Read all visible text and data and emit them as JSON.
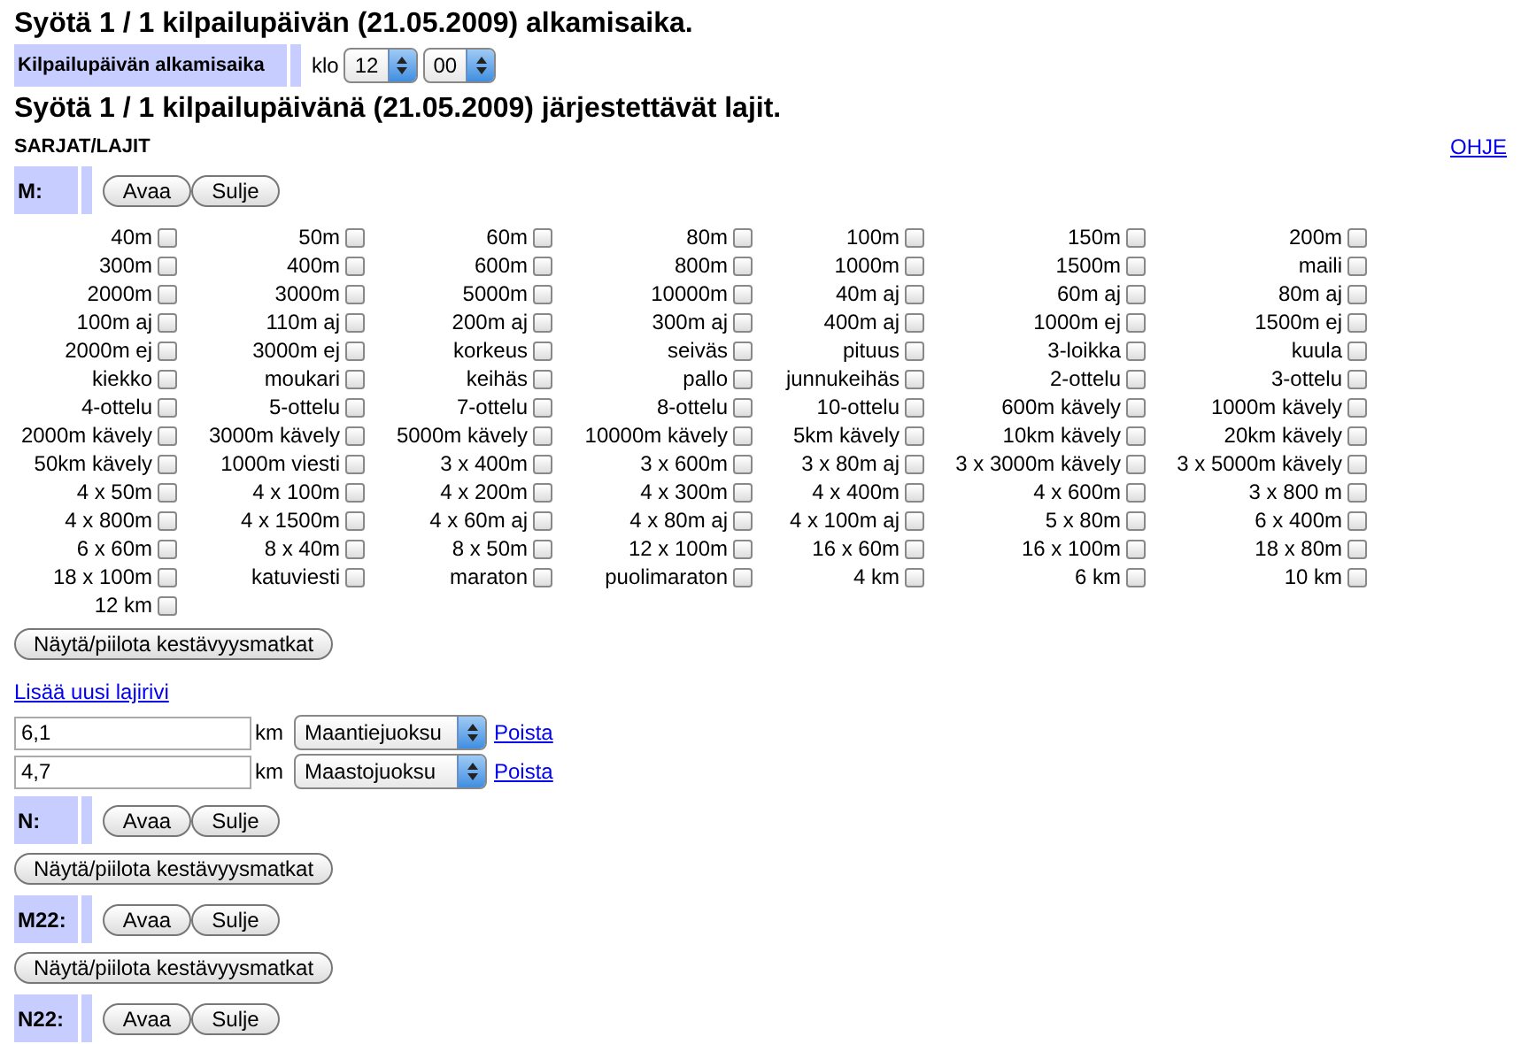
{
  "heading_start": "Syötä 1 / 1 kilpailupäivän (21.05.2009) alkamisaika.",
  "start_time": {
    "label": "Kilpailupäivän alkamisaika",
    "prefix": "klo",
    "hour": "12",
    "minute": "00"
  },
  "heading_events": "Syötä 1 / 1 kilpailupäivänä (21.05.2009) järjestettävät lajit.",
  "section_label": "SARJAT/LAJIT",
  "help_link": "OHJE",
  "series": [
    {
      "name": "M:",
      "buttons": [
        "Avaa",
        "Sulje"
      ],
      "events": [
        {
          "label": "40m",
          "checked": false
        },
        {
          "label": "50m",
          "checked": false
        },
        {
          "label": "60m",
          "checked": false
        },
        {
          "label": "80m",
          "checked": false
        },
        {
          "label": "100m",
          "checked": false
        },
        {
          "label": "150m",
          "checked": false
        },
        {
          "label": "200m",
          "checked": false
        },
        {
          "label": "300m",
          "checked": false
        },
        {
          "label": "400m",
          "checked": false
        },
        {
          "label": "600m",
          "checked": false
        },
        {
          "label": "800m",
          "checked": false
        },
        {
          "label": "1000m",
          "checked": false
        },
        {
          "label": "1500m",
          "checked": false
        },
        {
          "label": "maili",
          "checked": false
        },
        {
          "label": "2000m",
          "checked": false
        },
        {
          "label": "3000m",
          "checked": false
        },
        {
          "label": "5000m",
          "checked": false
        },
        {
          "label": "10000m",
          "checked": false
        },
        {
          "label": "40m aj",
          "checked": false
        },
        {
          "label": "60m aj",
          "checked": false
        },
        {
          "label": "80m aj",
          "checked": false
        },
        {
          "label": "100m aj",
          "checked": false
        },
        {
          "label": "110m aj",
          "checked": false
        },
        {
          "label": "200m aj",
          "checked": false
        },
        {
          "label": "300m aj",
          "checked": false
        },
        {
          "label": "400m aj",
          "checked": false
        },
        {
          "label": "1000m ej",
          "checked": false
        },
        {
          "label": "1500m ej",
          "checked": false
        },
        {
          "label": "2000m ej",
          "checked": false
        },
        {
          "label": "3000m ej",
          "checked": false
        },
        {
          "label": "korkeus",
          "checked": false
        },
        {
          "label": "seiväs",
          "checked": false
        },
        {
          "label": "pituus",
          "checked": false
        },
        {
          "label": "3-loikka",
          "checked": false
        },
        {
          "label": "kuula",
          "checked": false
        },
        {
          "label": "kiekko",
          "checked": false
        },
        {
          "label": "moukari",
          "checked": false
        },
        {
          "label": "keihäs",
          "checked": false
        },
        {
          "label": "pallo",
          "checked": false
        },
        {
          "label": "junnukeihäs",
          "checked": false
        },
        {
          "label": "2-ottelu",
          "checked": false
        },
        {
          "label": "3-ottelu",
          "checked": false
        },
        {
          "label": "4-ottelu",
          "checked": false
        },
        {
          "label": "5-ottelu",
          "checked": false
        },
        {
          "label": "7-ottelu",
          "checked": false
        },
        {
          "label": "8-ottelu",
          "checked": false
        },
        {
          "label": "10-ottelu",
          "checked": false
        },
        {
          "label": "600m kävely",
          "checked": false
        },
        {
          "label": "1000m kävely",
          "checked": false
        },
        {
          "label": "2000m kävely",
          "checked": false
        },
        {
          "label": "3000m kävely",
          "checked": false
        },
        {
          "label": "5000m kävely",
          "checked": false
        },
        {
          "label": "10000m kävely",
          "checked": false
        },
        {
          "label": "5km kävely",
          "checked": false
        },
        {
          "label": "10km kävely",
          "checked": false
        },
        {
          "label": "20km kävely",
          "checked": false
        },
        {
          "label": "50km kävely",
          "checked": false
        },
        {
          "label": "1000m viesti",
          "checked": false
        },
        {
          "label": "3 x 400m",
          "checked": false
        },
        {
          "label": "3 x 600m",
          "checked": false
        },
        {
          "label": "3 x 80m aj",
          "checked": false
        },
        {
          "label": "3 x 3000m kävely",
          "checked": false
        },
        {
          "label": "3 x 5000m kävely",
          "checked": false
        },
        {
          "label": "4 x 50m",
          "checked": false
        },
        {
          "label": "4 x 100m",
          "checked": false
        },
        {
          "label": "4 x 200m",
          "checked": false
        },
        {
          "label": "4 x 300m",
          "checked": false
        },
        {
          "label": "4 x 400m",
          "checked": false
        },
        {
          "label": "4 x 600m",
          "checked": false
        },
        {
          "label": "3 x 800 m",
          "checked": false
        },
        {
          "label": "4 x 800m",
          "checked": false
        },
        {
          "label": "4 x 1500m",
          "checked": false
        },
        {
          "label": "4 x 60m aj",
          "checked": false
        },
        {
          "label": "4 x 80m aj",
          "checked": false
        },
        {
          "label": "4 x 100m aj",
          "checked": false
        },
        {
          "label": "5 x 80m",
          "checked": false
        },
        {
          "label": "6 x 400m",
          "checked": false
        },
        {
          "label": "6 x 60m",
          "checked": false
        },
        {
          "label": "8 x 40m",
          "checked": false
        },
        {
          "label": "8 x 50m",
          "checked": false
        },
        {
          "label": "12 x 100m",
          "checked": false
        },
        {
          "label": "16 x 60m",
          "checked": false
        },
        {
          "label": "16 x 100m",
          "checked": false
        },
        {
          "label": "18 x 80m",
          "checked": false
        },
        {
          "label": "18 x 100m",
          "checked": false
        },
        {
          "label": "katuviesti",
          "checked": false
        },
        {
          "label": "maraton",
          "checked": false
        },
        {
          "label": "puolimaraton",
          "checked": false
        },
        {
          "label": "4 km",
          "checked": false
        },
        {
          "label": "6 km",
          "checked": false
        },
        {
          "label": "10 km",
          "checked": false
        },
        {
          "label": "12 km",
          "checked": false
        }
      ],
      "toggle_button": "Näytä/piilota kestävyysmatkat",
      "add_link": "Lisää uusi lajirivi",
      "custom_rows": [
        {
          "distance": "6,1",
          "unit": "km",
          "type": "Maantiejuoksu",
          "remove": "Poista"
        },
        {
          "distance": "4,7",
          "unit": "km",
          "type": "Maastojuoksu",
          "remove": "Poista"
        }
      ]
    },
    {
      "name": "N:",
      "buttons": [
        "Avaa",
        "Sulje"
      ],
      "toggle_button": "Näytä/piilota kestävyysmatkat"
    },
    {
      "name": "M22:",
      "buttons": [
        "Avaa",
        "Sulje"
      ],
      "toggle_button": "Näytä/piilota kestävyysmatkat"
    },
    {
      "name": "N22:",
      "buttons": [
        "Avaa",
        "Sulje"
      ]
    }
  ]
}
